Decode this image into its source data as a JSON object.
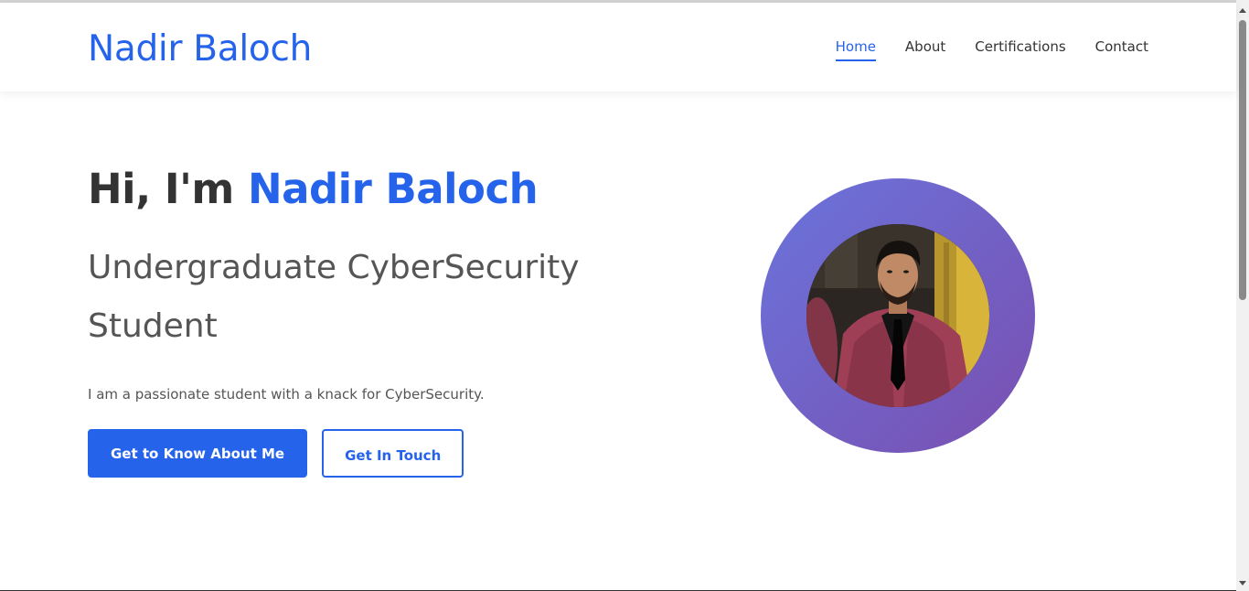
{
  "brand": {
    "name": "Nadir Baloch",
    "accent_color": "#2563eb"
  },
  "nav": {
    "items": [
      {
        "label": "Home",
        "active": true
      },
      {
        "label": "About",
        "active": false
      },
      {
        "label": "Certifications",
        "active": false
      },
      {
        "label": "Contact",
        "active": false
      }
    ]
  },
  "hero": {
    "greeting": "Hi, I'm",
    "name": "Nadir Baloch",
    "subtitle": "Undergraduate CyberSecurity Student",
    "description": "I am a passionate student with a knack for CyberSecurity.",
    "primary_button": "Get to Know About Me",
    "secondary_button": "Get In Touch"
  },
  "profile": {
    "ring_gradient": [
      "#6a74dc",
      "#7a4fb0"
    ],
    "photo_icon": "profile-photo"
  }
}
